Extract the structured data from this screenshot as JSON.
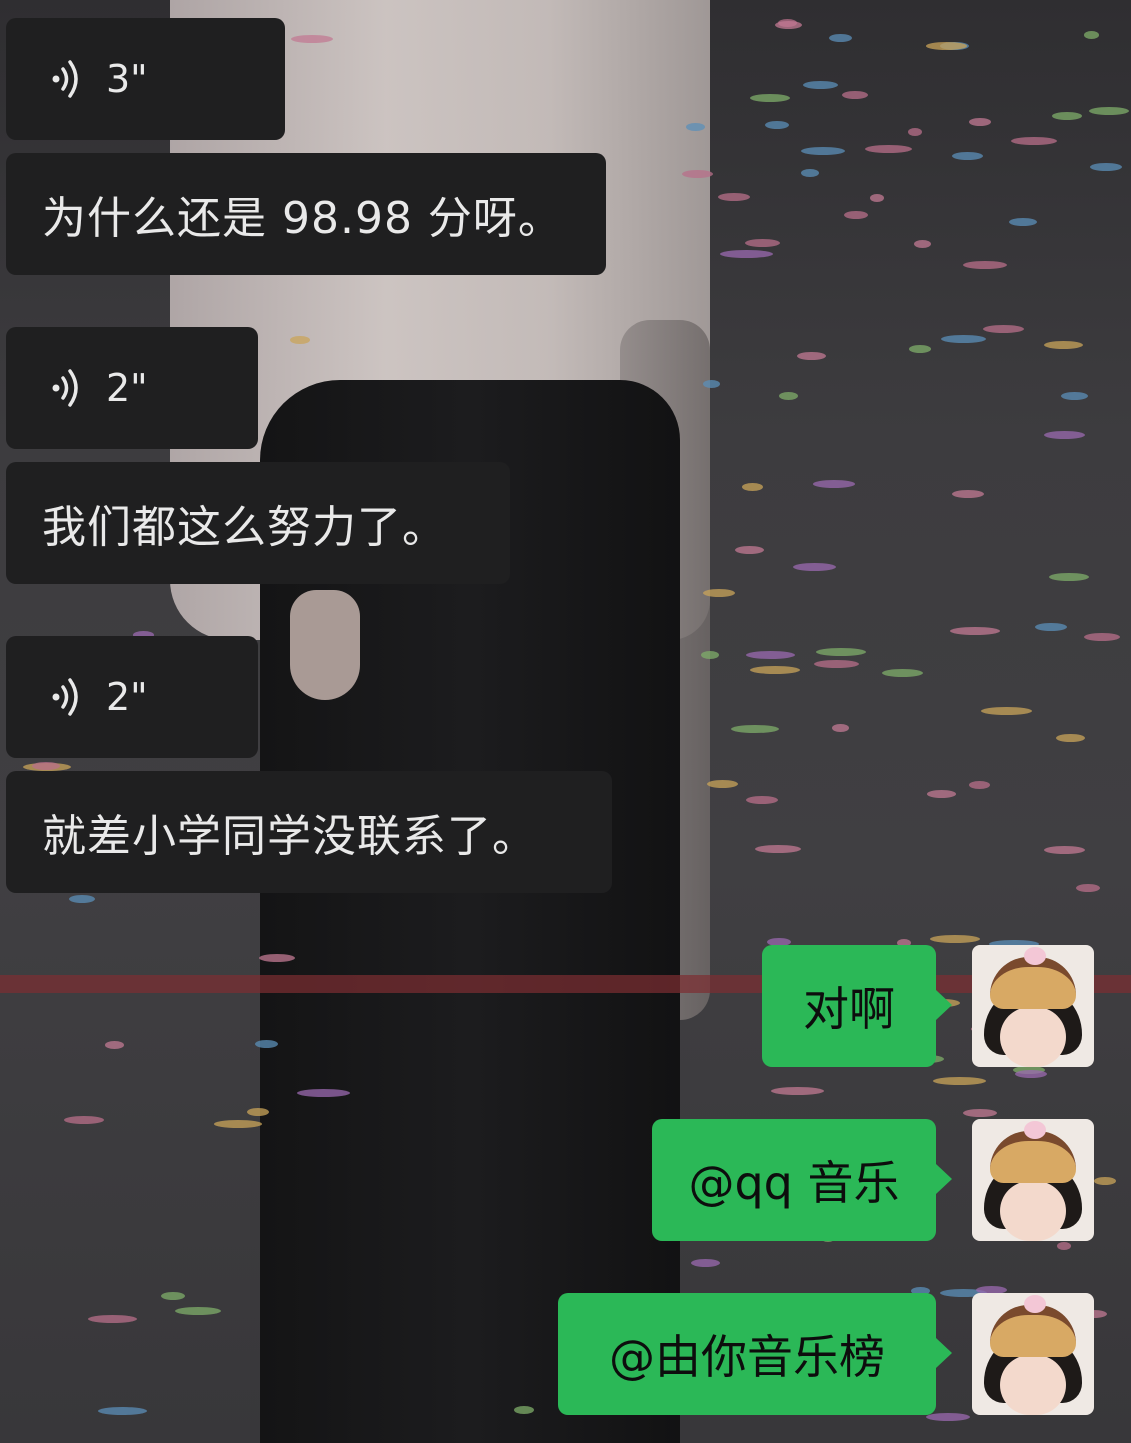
{
  "messages_left": [
    {
      "type": "voice",
      "duration": "3\""
    },
    {
      "type": "text",
      "text": "为什么还是 98.98 分呀。"
    },
    {
      "type": "voice",
      "duration": "2\""
    },
    {
      "type": "text",
      "text": "我们都这么努力了。"
    },
    {
      "type": "voice",
      "duration": "2\""
    },
    {
      "type": "text",
      "text": "就差小学同学没联系了。"
    }
  ],
  "messages_right": [
    {
      "text": "对啊"
    },
    {
      "text": "@qq 音乐"
    },
    {
      "text": "@由你音乐榜"
    }
  ],
  "icons": {
    "voice": "speaker-wave-icon",
    "avatar": "user-avatar"
  },
  "colors": {
    "left_bubble": "#1f1f20",
    "right_bubble": "#2bb857",
    "left_text": "#e9e9e9"
  }
}
